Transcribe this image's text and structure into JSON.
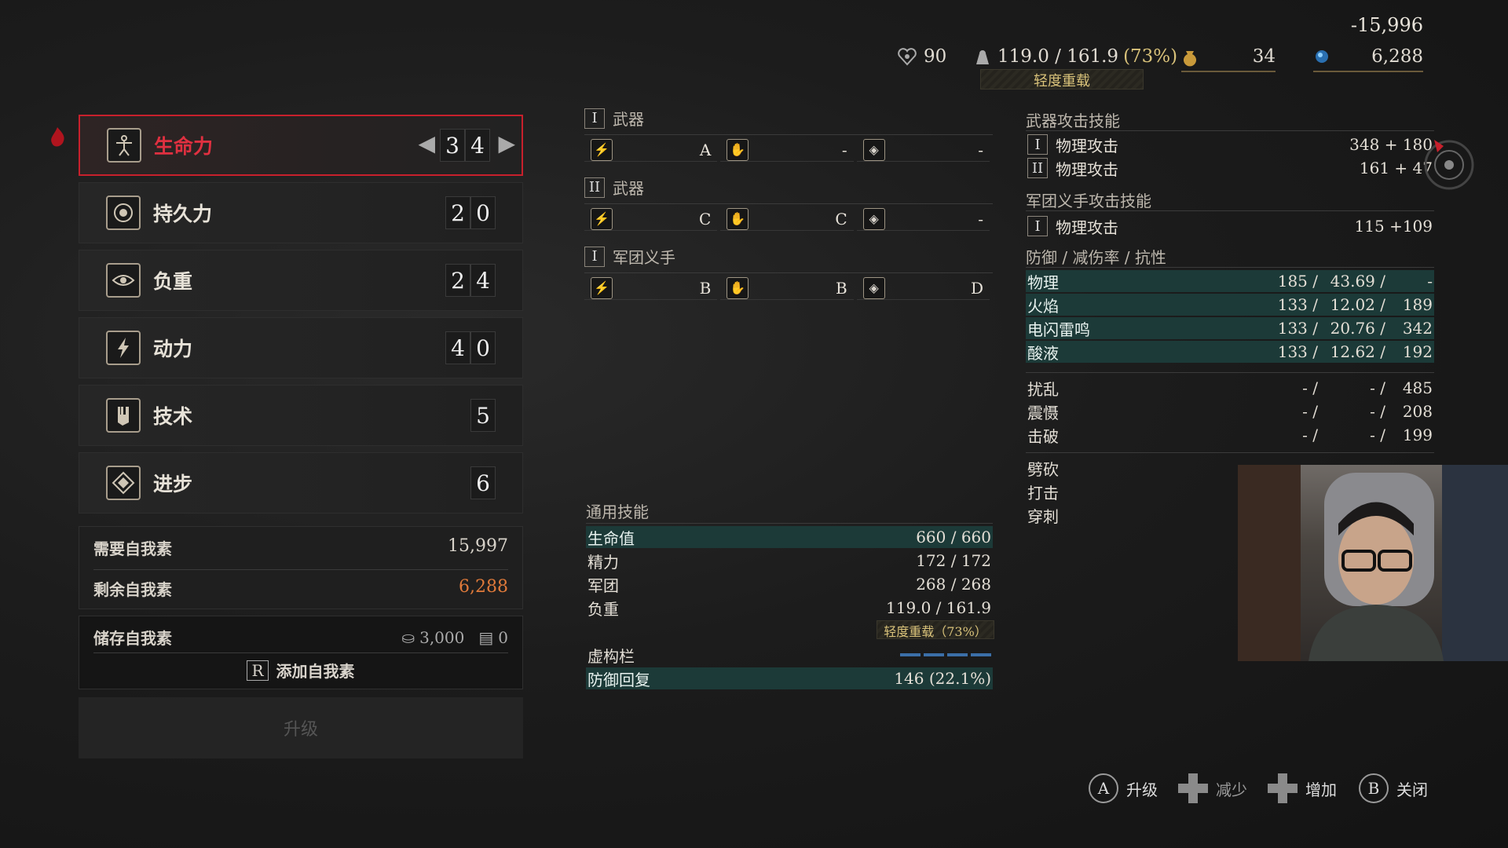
{
  "topbar": {
    "delta": "-15,996",
    "level": "90",
    "weight": "119.0 / 161.9",
    "weight_pct": "(73%)",
    "load_status": "轻度重载",
    "item_count": "34",
    "ergo": "6,288"
  },
  "attributes": [
    {
      "label": "生命力",
      "d1": "3",
      "d2": "4",
      "icon": "vitruvian-icon"
    },
    {
      "label": "持久力",
      "d1": "2",
      "d2": "0",
      "icon": "target-icon"
    },
    {
      "label": "负重",
      "d1": "2",
      "d2": "4",
      "icon": "eye-icon"
    },
    {
      "label": "动力",
      "d1": "4",
      "d2": "0",
      "icon": "lightning-icon"
    },
    {
      "label": "技术",
      "d1": "",
      "d2": "5",
      "icon": "gauntlet-icon"
    },
    {
      "label": "进步",
      "d1": "",
      "d2": "6",
      "icon": "diamond-icon"
    }
  ],
  "ergo_panel": {
    "required_label": "需要自我素",
    "required_value": "15,997",
    "remaining_label": "剩余自我素",
    "remaining_value": "6,288",
    "stored_label": "储存自我素",
    "stored_value": "3,000",
    "stored_items": "0",
    "add_label": "添加自我素",
    "add_key": "R"
  },
  "upgrade_label": "升级",
  "weapons": [
    {
      "roman": "I",
      "title": "武器",
      "grades": [
        "A",
        "-",
        "-"
      ]
    },
    {
      "roman": "II",
      "title": "武器",
      "grades": [
        "C",
        "C",
        "-"
      ]
    },
    {
      "roman": "I",
      "title": "军团义手",
      "grades": [
        "B",
        "B",
        "D"
      ]
    }
  ],
  "general": {
    "title": "通用技能",
    "rows": [
      {
        "k": "生命值",
        "v": "660 /    660",
        "hl": true
      },
      {
        "k": "精力",
        "v": "172 /    172",
        "hl": false
      },
      {
        "k": "军团",
        "v": "268 /    268",
        "hl": false
      },
      {
        "k": "负重",
        "v": "119.0 / 161.9",
        "hl": false
      }
    ],
    "load_tag": "轻度重载（73%）",
    "fiction_label": "虚构栏",
    "guard_label": "防御回复",
    "guard_value": "146 (22.1%)"
  },
  "right": {
    "weapon_atk_title": "武器攻击技能",
    "weapon_atk": [
      {
        "roman": "I",
        "k": "物理攻击",
        "v": "348 + 180"
      },
      {
        "roman": "II",
        "k": "物理攻击",
        "v": "161 + 47"
      }
    ],
    "legion_atk_title": "军团义手攻击技能",
    "legion_atk": [
      {
        "roman": "I",
        "k": "物理攻击",
        "v": "115 +109"
      }
    ],
    "defense_title": "防御 / 减伤率 / 抗性",
    "defense": [
      {
        "k": "物理",
        "a": "185 /",
        "b": "43.69 /",
        "c": "-"
      },
      {
        "k": "火焰",
        "a": "133 /",
        "b": "12.02 /",
        "c": "189"
      },
      {
        "k": "电闪雷鸣",
        "a": "133 /",
        "b": "20.76 /",
        "c": "342"
      },
      {
        "k": "酸液",
        "a": "133 /",
        "b": "12.62 /",
        "c": "192"
      }
    ],
    "status": [
      {
        "k": "扰乱",
        "a": "- /",
        "b": "- /",
        "c": "485"
      },
      {
        "k": "震慑",
        "a": "- /",
        "b": "- /",
        "c": "208"
      },
      {
        "k": "击破",
        "a": "- /",
        "b": "- /",
        "c": "199"
      }
    ],
    "damage_types": [
      "劈砍",
      "打击",
      "穿刺"
    ]
  },
  "controls": [
    {
      "btn": "A",
      "label": "升级",
      "type": "circle"
    },
    {
      "btn": "",
      "label": "减少",
      "type": "dpad"
    },
    {
      "btn": "",
      "label": "增加",
      "type": "dpad"
    },
    {
      "btn": "B",
      "label": "关闭",
      "type": "circle"
    }
  ],
  "colors": {
    "accent_red": "#c8202c",
    "highlight_teal": "#1c3a38",
    "remaining_orange": "#e07a3a",
    "load_yellow": "#d9c27a"
  }
}
